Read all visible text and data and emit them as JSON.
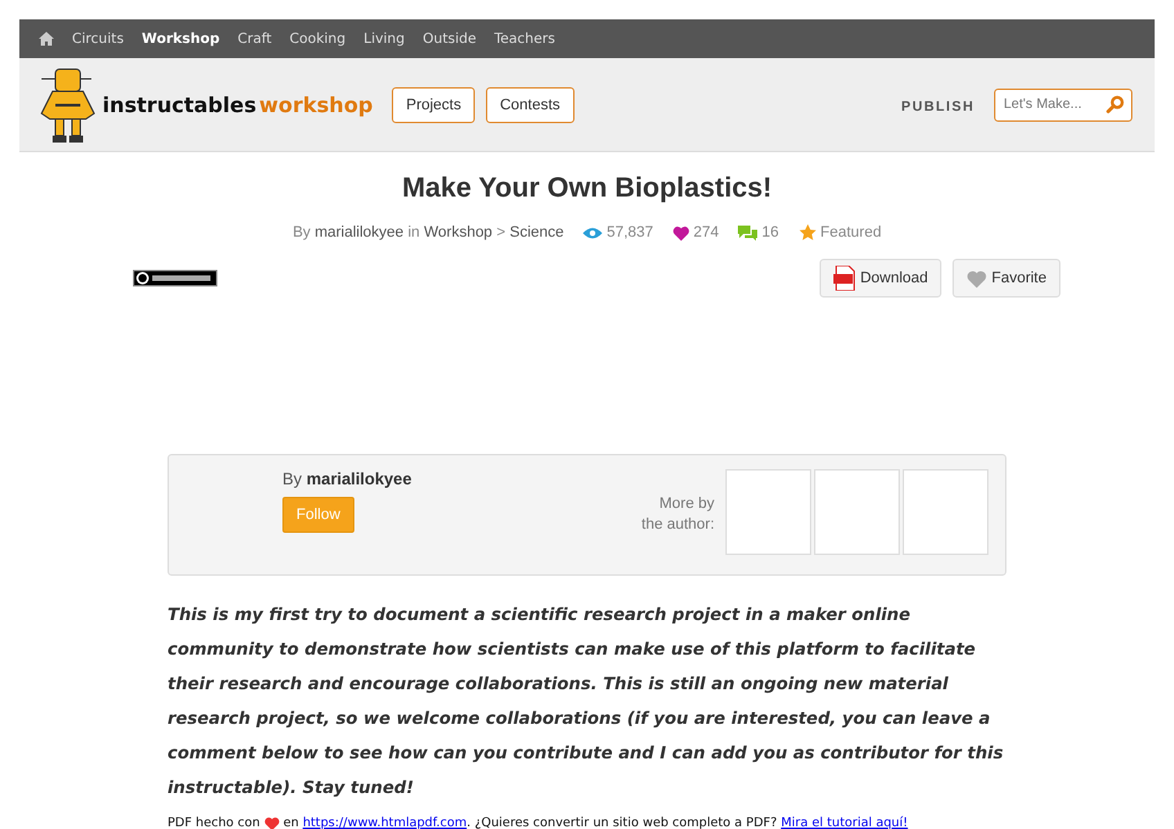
{
  "top_nav": {
    "items": [
      {
        "label": "Circuits",
        "selected": false
      },
      {
        "label": "Workshop",
        "selected": true
      },
      {
        "label": "Craft",
        "selected": false
      },
      {
        "label": "Cooking",
        "selected": false
      },
      {
        "label": "Living",
        "selected": false
      },
      {
        "label": "Outside",
        "selected": false
      },
      {
        "label": "Teachers",
        "selected": false
      }
    ]
  },
  "header": {
    "logo_name": "instructables",
    "logo_channel": "workshop",
    "buttons": [
      "Projects",
      "Contests"
    ],
    "publish": "PUBLISH",
    "search": {
      "placeholder": "Let's Make..."
    }
  },
  "article": {
    "title": "Make Your Own Bioplastics!",
    "byline": {
      "by": "By",
      "author": "marialilokyee",
      "in": "in",
      "category": "Workshop",
      "separator": ">",
      "subcategory": "Science"
    },
    "stats": {
      "views": "57,837",
      "favorites": "274",
      "comments": "16",
      "featured": "Featured"
    },
    "actions": [
      "Download",
      "Favorite"
    ]
  },
  "author_card": {
    "by": "By",
    "name": "marialilokyee",
    "follow": "Follow",
    "more_by": "More by the author:",
    "tiles": [
      {
        "kind": "empty"
      },
      {
        "kind": "empty"
      },
      {
        "kind": "empty"
      }
    ]
  },
  "description": "This is my first try to document a scientific research project in a maker online community to demonstrate how scientists can make use of this platform to facilitate their research and encourage collaborations. This is still an ongoing new material research project, so we welcome collaborations (if you are interested, you can leave a comment below to see how can you contribute and I can add you as contributor for this instructable). Stay tuned!",
  "footer": {
    "before": "PDF hecho con",
    "middle": "en",
    "link": "https://www.htmlapdf.com",
    "after": ". ¿Quieres convertir un sitio web completo a PDF?",
    "tutorial_link": "Mira el tutorial aquí!"
  }
}
